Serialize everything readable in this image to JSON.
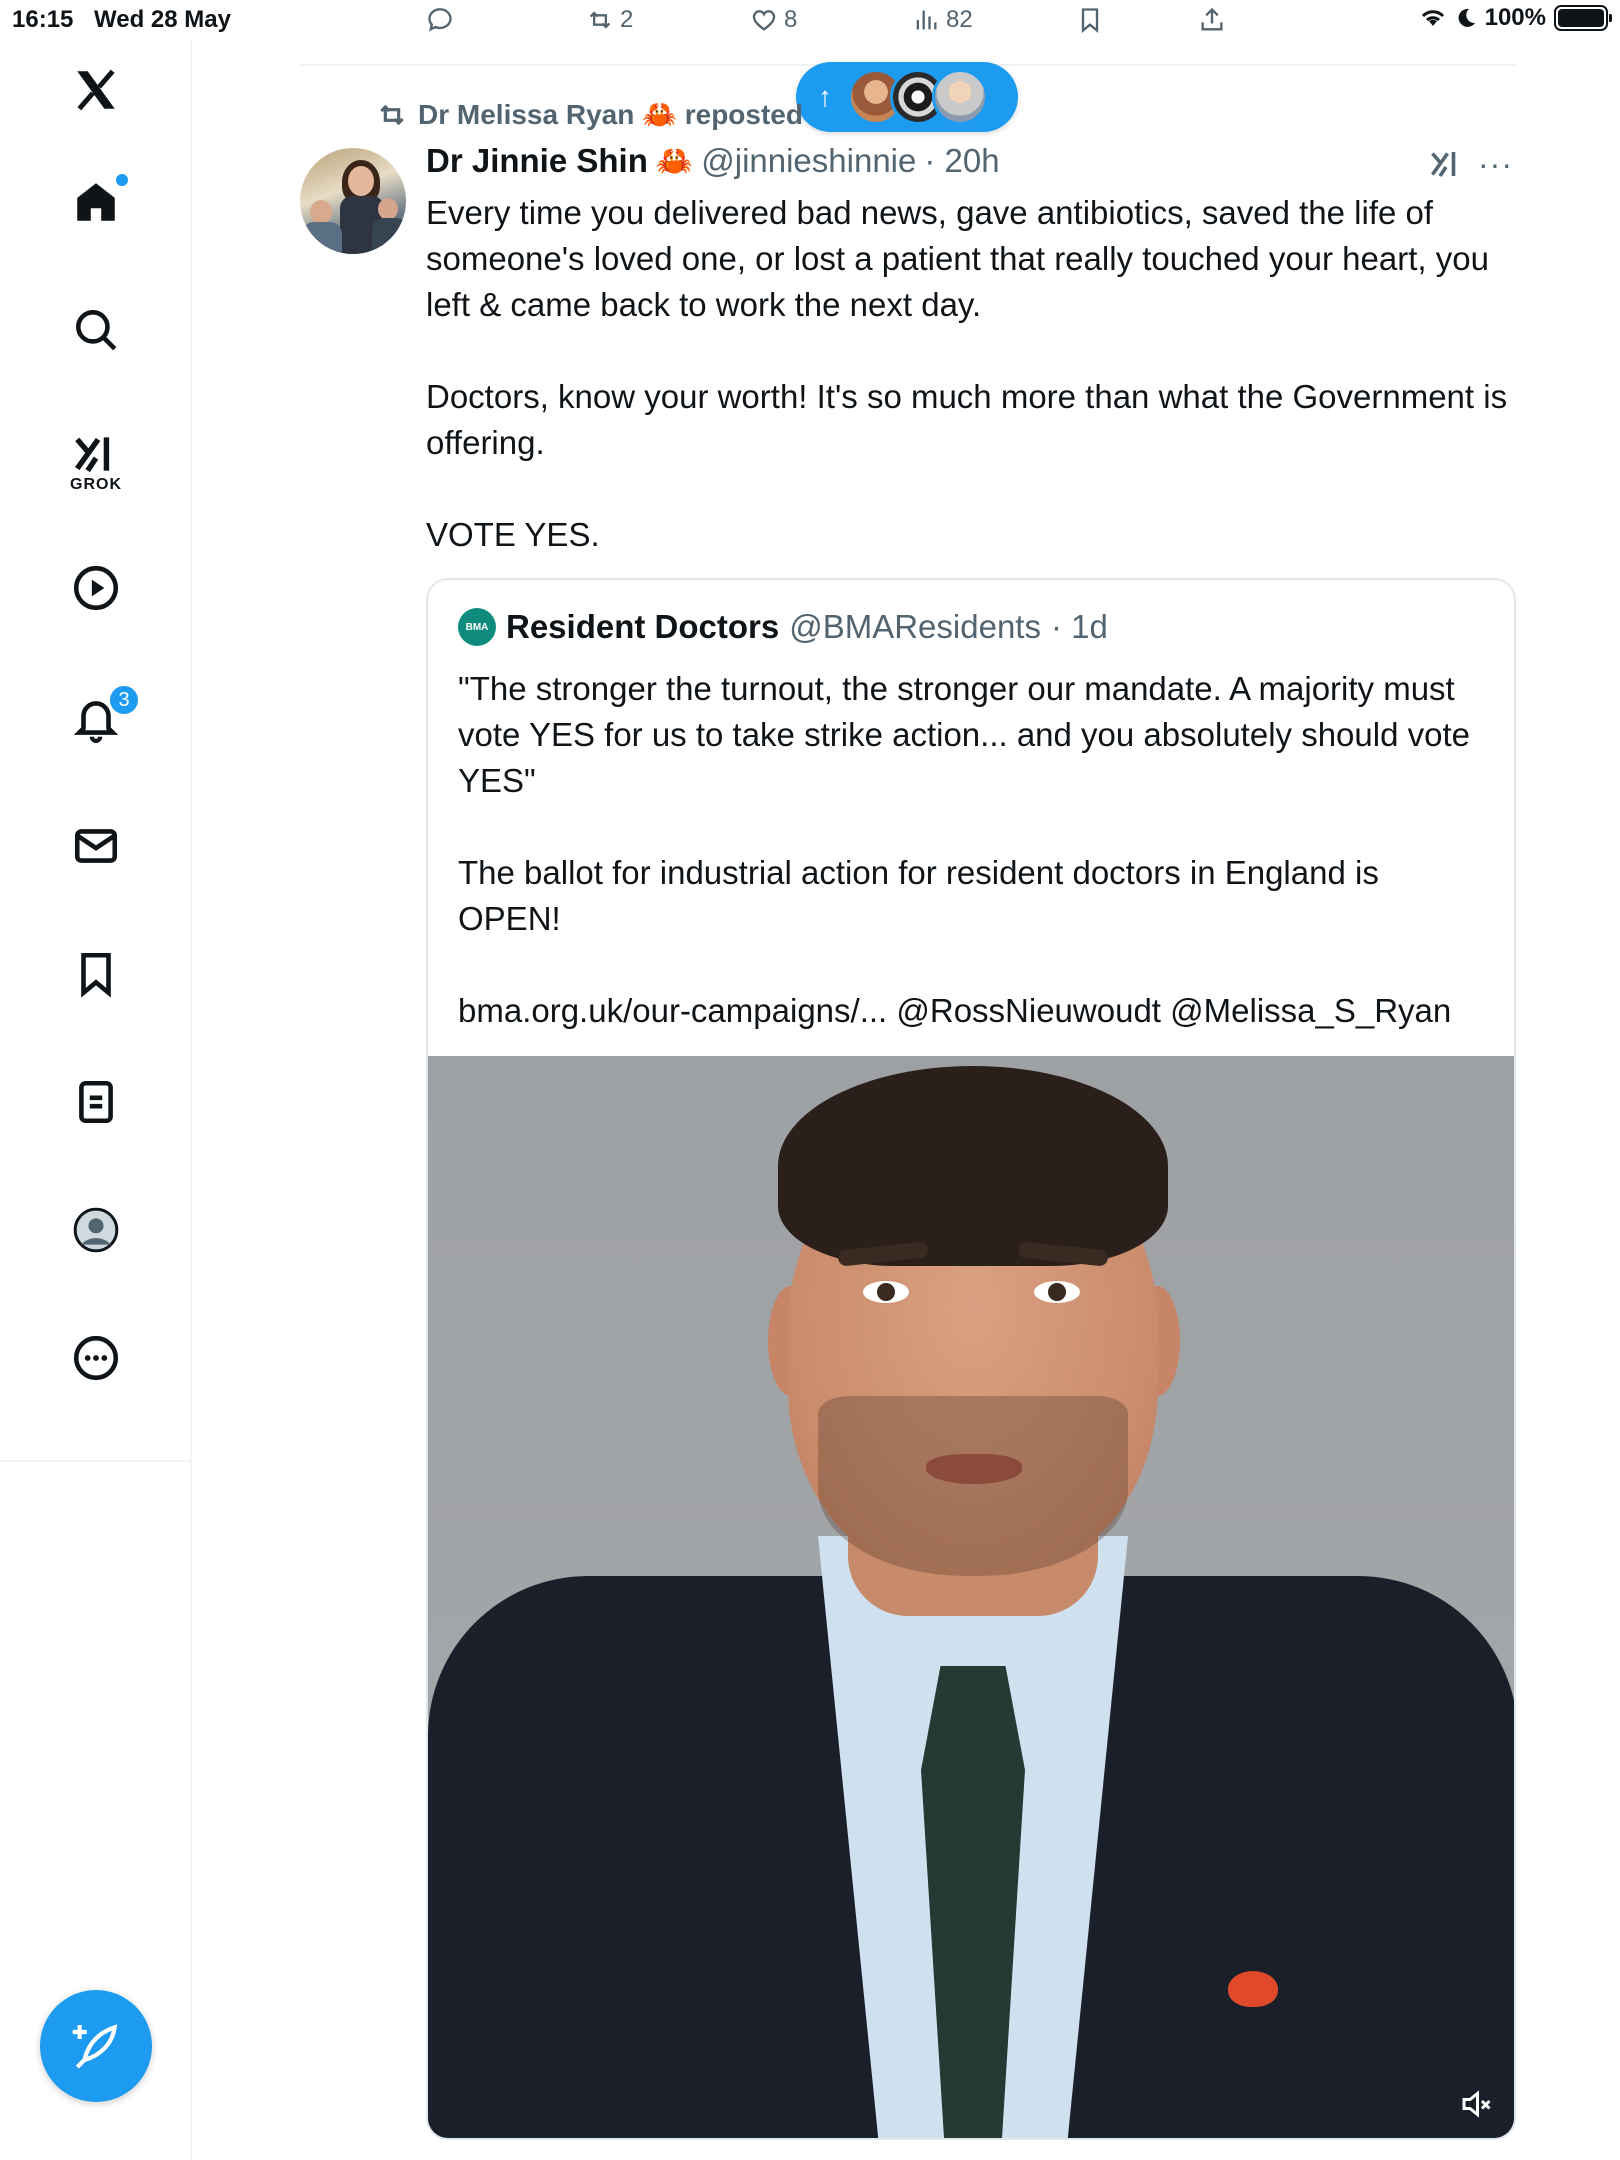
{
  "status_bar": {
    "time": "16:15",
    "date": "Wed 28 May",
    "battery": "100%"
  },
  "prev_tweet_actions": {
    "reposts": "2",
    "likes": "8",
    "views": "82"
  },
  "new_posts_pill": {
    "arrow": "↑"
  },
  "sidebar": {
    "grok_label": "GROK",
    "notifications_badge": "3"
  },
  "tweet": {
    "repost_by": "Dr Melissa Ryan 🦀 reposted",
    "author_name": "Dr Jinnie Shin",
    "author_emoji": "🦀",
    "handle": "@jinnieshinnie",
    "time": "· 20h",
    "more": "···",
    "text": "Every time you delivered bad news, gave antibiotics, saved the life of someone's loved one, or lost a patient that really touched your heart, you left & came back to work the next day.\n\nDoctors, know your worth! It's so much more than what the Government is offering.\n\nVOTE YES."
  },
  "quote": {
    "logo_text": "BMA",
    "name": "Resident Doctors",
    "handle": "@BMAResidents",
    "time": "· 1d",
    "text": "\"The stronger the turnout, the stronger our mandate. A majority must vote YES for us to take strike action... and you absolutely should vote YES\"\n\nThe ballot for industrial action for resident doctors in England is OPEN!\n\nbma.org.uk/our-campaigns/... @RossNieuwoudt @Melissa_S_Ryan"
  },
  "colors": {
    "accent": "#1d9bf0",
    "text_primary": "#0f1419",
    "text_secondary": "#536471",
    "bma_green": "#0f8b7e"
  }
}
